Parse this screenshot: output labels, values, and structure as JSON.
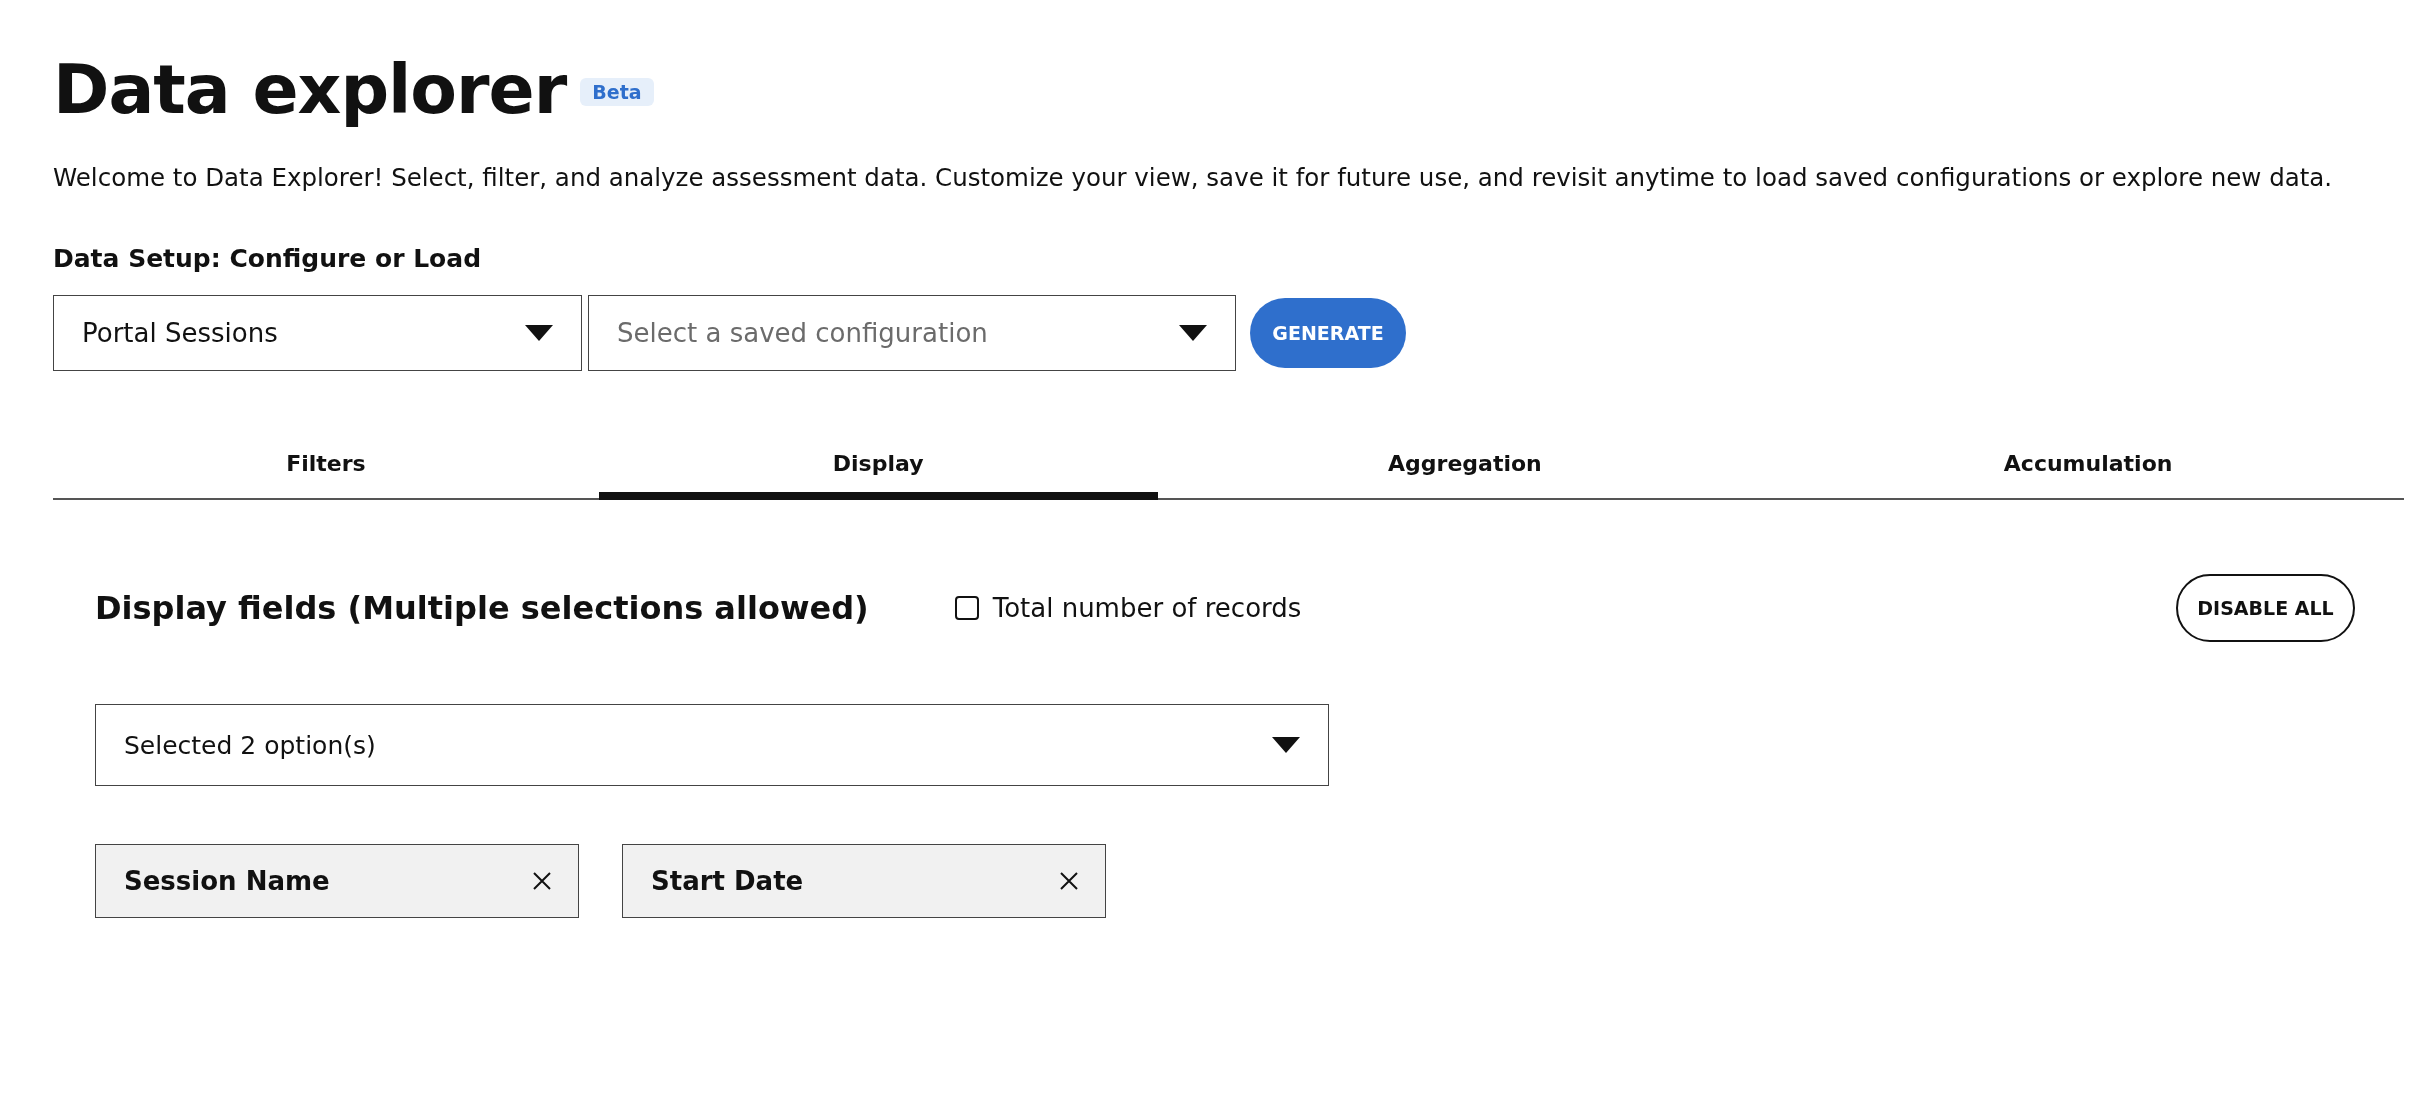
{
  "header": {
    "title": "Data explorer",
    "badge": "Beta",
    "description": "Welcome to Data Explorer! Select, filter, and analyze assessment data. Customize your view, save it for future use, and revisit anytime to load saved configurations or explore new data."
  },
  "setup": {
    "label": "Data Setup: Configure or Load",
    "source_select": {
      "value": "Portal Sessions"
    },
    "config_select": {
      "placeholder": "Select a saved configuration"
    },
    "generate_button": "GENERATE"
  },
  "tabs": [
    {
      "label": "Filters",
      "selected": false
    },
    {
      "label": "Display",
      "selected": true
    },
    {
      "label": "Aggregation",
      "selected": false
    },
    {
      "label": "Accumulation",
      "selected": false
    }
  ],
  "display": {
    "heading": "Display fields (Multiple selections allowed)",
    "total_checkbox": {
      "label": "Total number of records",
      "checked": false
    },
    "disable_all_button": "DISABLE ALL",
    "fields_select": {
      "value": "Selected 2 option(s)"
    },
    "chips": [
      {
        "label": "Session Name"
      },
      {
        "label": "Start Date"
      }
    ]
  }
}
